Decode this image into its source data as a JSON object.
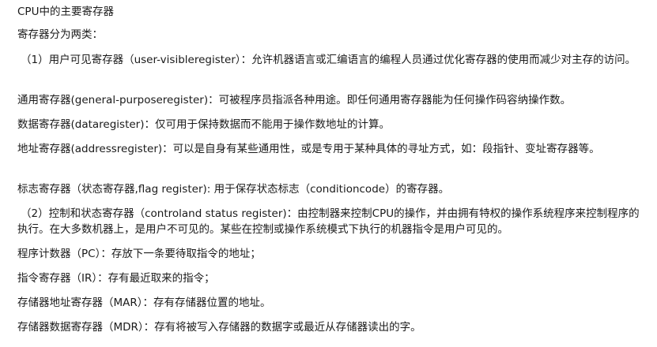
{
  "document": {
    "title": "CPU中的主要寄存器",
    "intro": "寄存器分为两类：",
    "p1": "（1）用户可见寄存器（user-visibleregister）：允许机器语言或汇编语言的编程人员通过优化寄存器的使用而减少对主存的访问。",
    "p2": "通用寄存器(general-purposeregister)：可被程序员指派各种用途。即任何通用寄存器能为任何操作码容纳操作数。",
    "p3": "数据寄存器(dataregister)：仅可用于保持数据而不能用于操作数地址的计算。",
    "p4": "地址寄存器(addressregister)：可以是自身有某些通用性，或是专用于某种具体的寻址方式，如：段指针、变址寄存器等。",
    "p5": "标志寄存器（状态寄存器,flag register): 用于保存状态标志（conditioncode）的寄存器。",
    "p6": "（2）控制和状态寄存器（controland status register)：由控制器来控制CPU的操作，并由拥有特权的操作系统程序来控制程序的执行。在大多数机器上，是用户不可见的。某些在控制或操作系统模式下执行的机器指令是用户可见的。",
    "p7": "程序计数器（PC）：存放下一条要待取指令的地址；",
    "p8": "指令寄存器（IR）：存有最近取来的指令；",
    "p9": "存储器地址寄存器（MAR）：存有存储器位置的地址。",
    "p10": "存储器数据寄存器（MDR）：存有将被写入存储器的数据字或最近从存储器读出的字。"
  }
}
